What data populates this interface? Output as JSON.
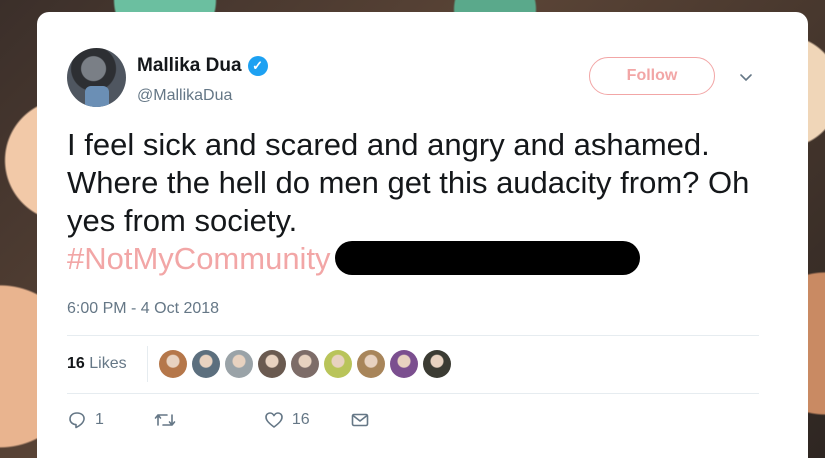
{
  "tweet": {
    "display_name": "Mallika Dua",
    "handle": "@MallikaDua",
    "follow_label": "Follow",
    "text": "I feel sick and scared and angry and ashamed. Where the hell do men get this audacity from? Oh yes from society.",
    "hashtag": "#NotMyCommunity",
    "timestamp": "6:00 PM - 4 Oct 2018",
    "likes_count": "16",
    "likes_label": "Likes",
    "reply_count": "1",
    "retweet_count": "",
    "like_count": "16"
  },
  "colors": {
    "hashtag": "#f2a6a6",
    "follow": "#f2a6a6",
    "verified": "#1da1f2",
    "muted": "#657786"
  },
  "likers": [
    {
      "name": "liker-1",
      "color": "#b5774a"
    },
    {
      "name": "liker-2",
      "color": "#5c6f7e"
    },
    {
      "name": "liker-3",
      "color": "#9aa3a8"
    },
    {
      "name": "liker-4",
      "color": "#6a5a50"
    },
    {
      "name": "liker-5",
      "color": "#7d6c68"
    },
    {
      "name": "liker-6",
      "color": "#b9c45a"
    },
    {
      "name": "liker-7",
      "color": "#a8855a"
    },
    {
      "name": "liker-8",
      "color": "#7b4f8f"
    },
    {
      "name": "liker-9",
      "color": "#3b3b33"
    }
  ]
}
